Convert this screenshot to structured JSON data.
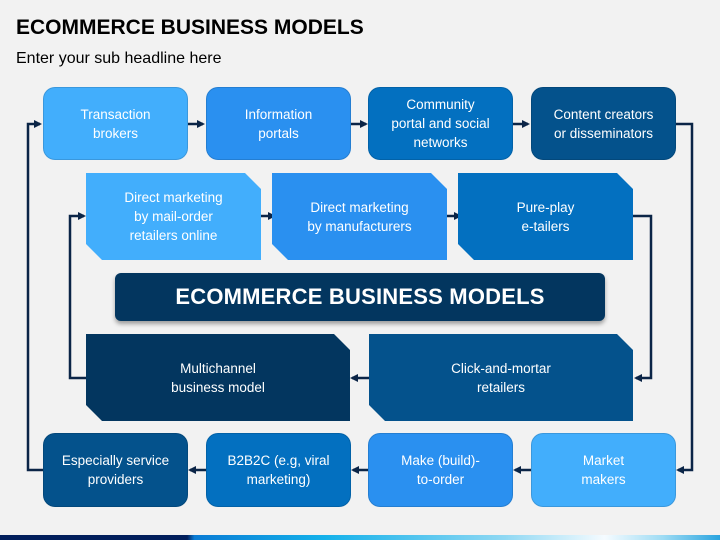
{
  "header": {
    "title": "ECOMMERCE BUSINESS MODELS",
    "subtitle": "Enter your sub headline here"
  },
  "center": {
    "title": "ECOMMERCE BUSINESS MODELS"
  },
  "colors": {
    "light_blue": "#42aefc",
    "medium_blue": "#2a90f0",
    "blue": "#0370c0",
    "dark_blue": "#04528c",
    "navy": "#03365f",
    "connector": "#0b2547",
    "background": "#f2f2f2"
  },
  "outer_loop": [
    {
      "label": "Transaction brokers",
      "line1": "Transaction",
      "line2": "brokers",
      "line3": ""
    },
    {
      "label": "Information portals",
      "line1": "Information",
      "line2": "portals",
      "line3": ""
    },
    {
      "label": "Community portal and social networks",
      "line1": "Community",
      "line2": "portal and social",
      "line3": "networks"
    },
    {
      "label": "Content creators or disseminators",
      "line1": "Content creators",
      "line2": "or disseminators",
      "line3": ""
    },
    {
      "label": "Market makers",
      "line1": "Market",
      "line2": "makers",
      "line3": ""
    },
    {
      "label": "Make (build)-to-order",
      "line1": "Make (build)-",
      "line2": "to-order",
      "line3": ""
    },
    {
      "label": "B2B2C (e.g, viral marketing)",
      "line1": "B2B2C (e.g, viral",
      "line2": "marketing)",
      "line3": ""
    },
    {
      "label": "Especially service providers",
      "line1": "Especially service",
      "line2": "providers",
      "line3": ""
    }
  ],
  "inner_loop": [
    {
      "label": "Direct marketing by mail-order retailers online",
      "line1": "Direct marketing",
      "line2": "by mail-order",
      "line3": "retailers online"
    },
    {
      "label": "Direct marketing by manufacturers",
      "line1": "Direct marketing",
      "line2": "by manufacturers",
      "line3": ""
    },
    {
      "label": "Pure-play e-tailers",
      "line1": "Pure-play",
      "line2": "e-tailers",
      "line3": ""
    },
    {
      "label": "Click-and-mortar retailers",
      "line1": "Click-and-mortar",
      "line2": "retailers",
      "line3": ""
    },
    {
      "label": "Multichannel business model",
      "line1": "Multichannel",
      "line2": "business model",
      "line3": ""
    }
  ]
}
